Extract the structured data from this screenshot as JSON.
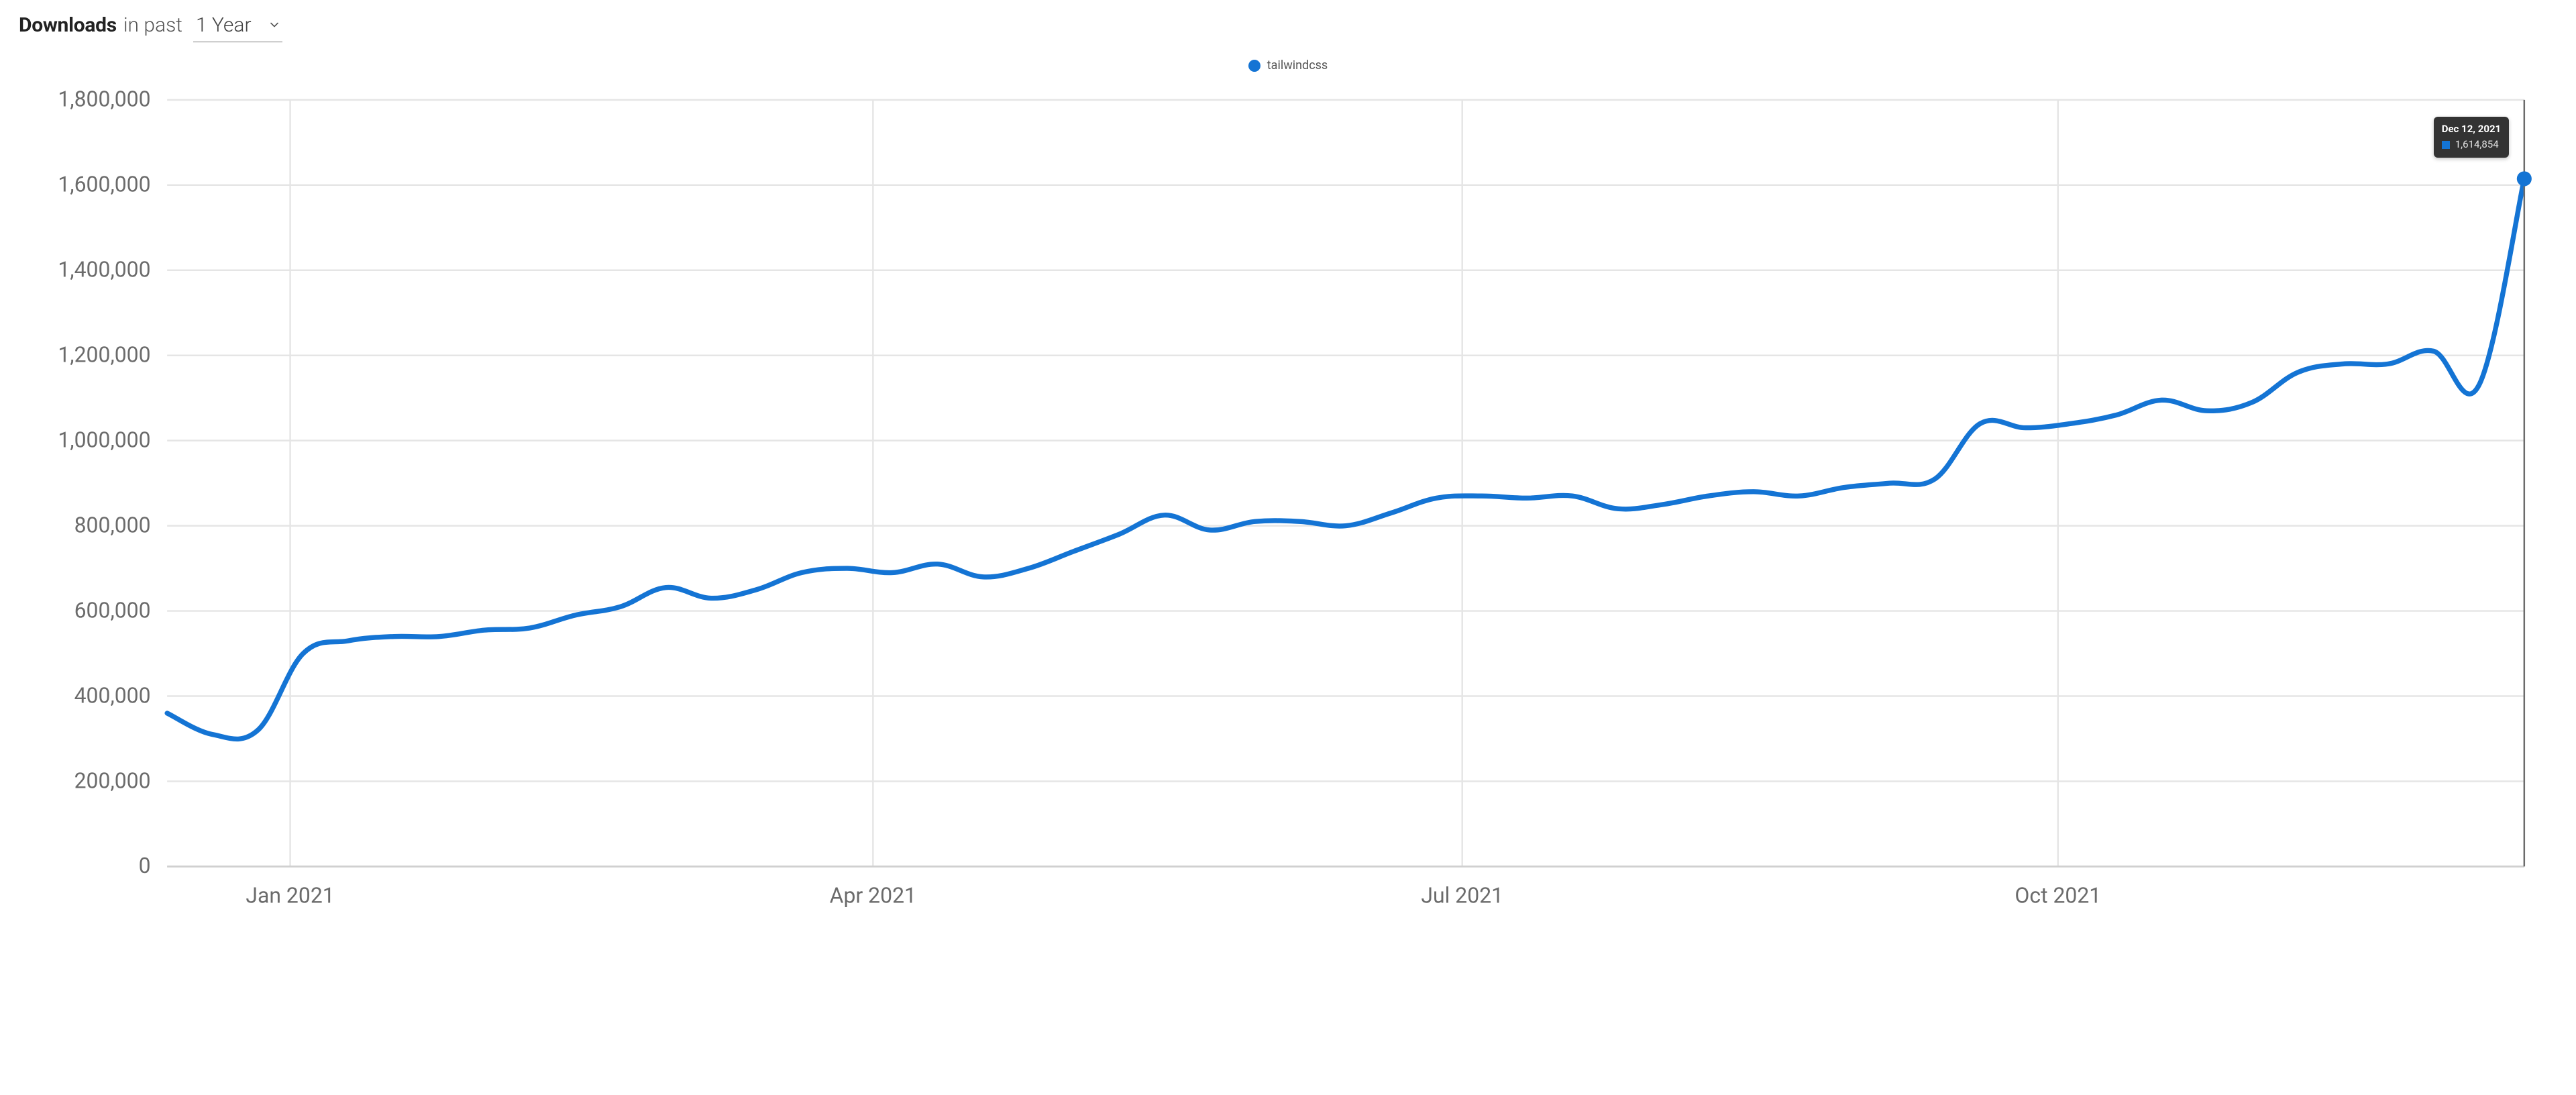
{
  "header": {
    "title_strong": "Downloads",
    "title_light": "in past",
    "range_selected": "1 Year"
  },
  "legend": {
    "series_name": "tailwindcss",
    "series_color": "#1474d4"
  },
  "tooltip": {
    "date_label": "Dec 12, 2021",
    "value_label": "1,614,854"
  },
  "chart_data": {
    "type": "line",
    "title": "Downloads in past 1 Year",
    "xlabel": "",
    "ylabel": "",
    "ylim": [
      0,
      1800000
    ],
    "x_range": [
      "2020-12-13",
      "2021-12-12"
    ],
    "y_ticks": [
      0,
      200000,
      400000,
      600000,
      800000,
      1000000,
      1200000,
      1400000,
      1600000,
      1800000
    ],
    "y_tick_labels": [
      "0",
      "200,000",
      "400,000",
      "600,000",
      "800,000",
      "1,000,000",
      "1,200,000",
      "1,400,000",
      "1,600,000",
      "1,800,000"
    ],
    "x_tick_dates": [
      "2021-01-01",
      "2021-04-01",
      "2021-07-01",
      "2021-10-01"
    ],
    "x_tick_labels": [
      "Jan 2021",
      "Apr 2021",
      "Jul 2021",
      "Oct 2021"
    ],
    "legend_position": "top-center",
    "grid": true,
    "series": [
      {
        "name": "tailwindcss",
        "color": "#1474d4",
        "x": [
          "2020-12-13",
          "2020-12-20",
          "2020-12-27",
          "2021-01-03",
          "2021-01-10",
          "2021-01-17",
          "2021-01-24",
          "2021-01-31",
          "2021-02-07",
          "2021-02-14",
          "2021-02-21",
          "2021-02-28",
          "2021-03-07",
          "2021-03-14",
          "2021-03-21",
          "2021-03-28",
          "2021-04-04",
          "2021-04-11",
          "2021-04-18",
          "2021-04-25",
          "2021-05-02",
          "2021-05-09",
          "2021-05-16",
          "2021-05-23",
          "2021-05-30",
          "2021-06-06",
          "2021-06-13",
          "2021-06-20",
          "2021-06-27",
          "2021-07-04",
          "2021-07-11",
          "2021-07-18",
          "2021-07-25",
          "2021-08-01",
          "2021-08-08",
          "2021-08-15",
          "2021-08-22",
          "2021-08-29",
          "2021-09-05",
          "2021-09-12",
          "2021-09-19",
          "2021-09-26",
          "2021-10-03",
          "2021-10-10",
          "2021-10-17",
          "2021-10-24",
          "2021-10-31",
          "2021-11-07",
          "2021-11-14",
          "2021-11-21",
          "2021-11-28",
          "2021-12-05",
          "2021-12-12"
        ],
        "values": [
          360000,
          310000,
          320000,
          500000,
          530000,
          540000,
          540000,
          555000,
          560000,
          590000,
          610000,
          655000,
          630000,
          650000,
          690000,
          700000,
          690000,
          710000,
          680000,
          700000,
          740000,
          780000,
          825000,
          790000,
          810000,
          810000,
          800000,
          830000,
          865000,
          870000,
          865000,
          870000,
          840000,
          850000,
          870000,
          880000,
          870000,
          890000,
          900000,
          910000,
          1040000,
          1030000,
          1040000,
          1060000,
          1095000,
          1070000,
          1090000,
          1160000,
          1180000,
          1180000,
          1210000,
          1130000,
          1614854
        ]
      }
    ],
    "highlight_point": {
      "series": "tailwindcss",
      "x": "2021-12-12",
      "y": 1614854
    }
  }
}
